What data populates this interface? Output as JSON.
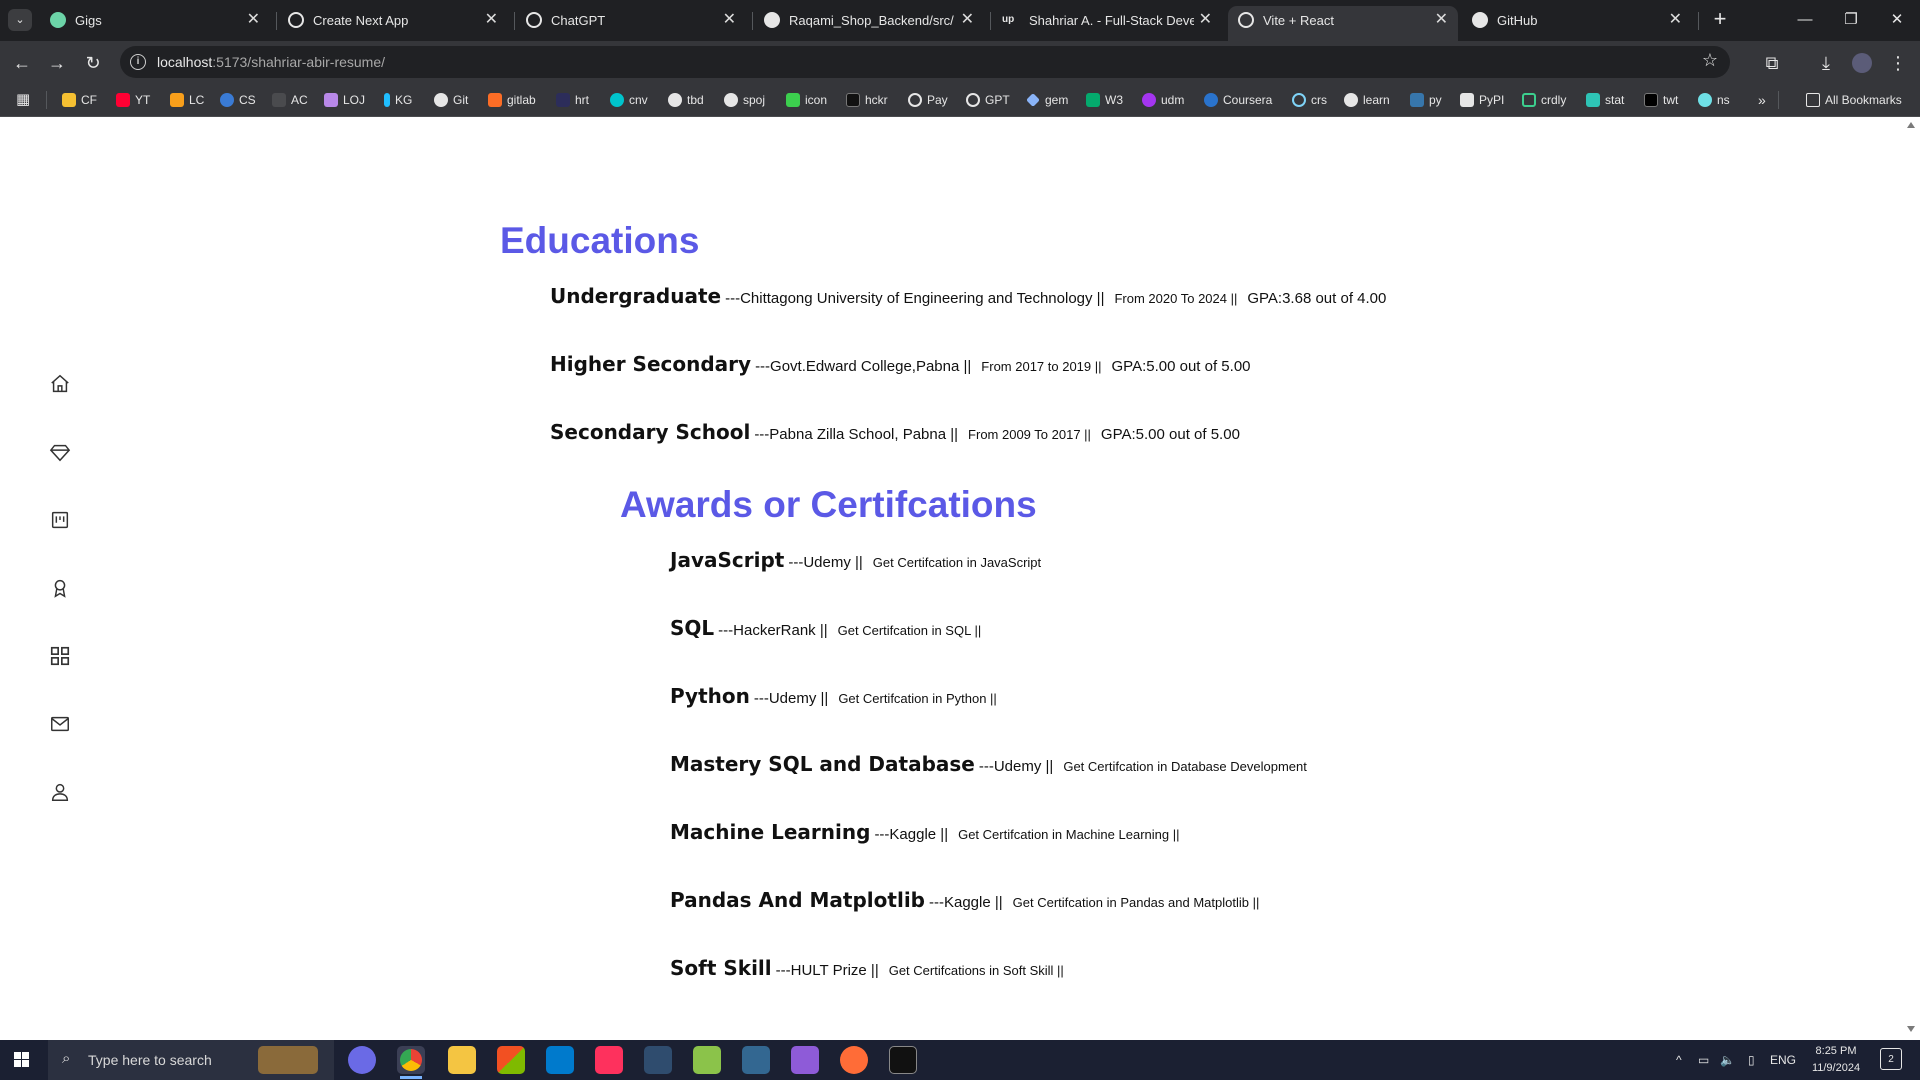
{
  "browser": {
    "tabs": [
      {
        "title": "Gigs",
        "fav_color": "#6cd4a8"
      },
      {
        "title": "Create Next App",
        "fav_color": "#e6e6e6"
      },
      {
        "title": "ChatGPT",
        "fav_color": "#e6e6e6"
      },
      {
        "title": "Raqami_Shop_Backend/src/mai",
        "fav_color": "#e6e6e6"
      },
      {
        "title": "Shahriar A. - Full-Stack Develop",
        "fav_color": "#e6e6e6"
      },
      {
        "title": "Vite + React",
        "fav_color": "#e6e6e6"
      },
      {
        "title": "GitHub",
        "fav_color": "#e6e6e6"
      }
    ],
    "active_tab_index": 5,
    "url_host": "localhost",
    "url_path": ":5173/shahriar-abir-resume/",
    "bookmarks": [
      "CF",
      "YT",
      "LC",
      "CS",
      "AC",
      "LOJ",
      "KG",
      "Git",
      "gitlab",
      "hrt",
      "cnv",
      "tbd",
      "spoj",
      "icon",
      "hckr",
      "Pay",
      "GPT",
      "gem",
      "W3",
      "udm",
      "Coursera",
      "crs",
      "learn",
      "py",
      "PyPI",
      "crdly",
      "stat",
      "twt",
      "ns"
    ],
    "all_bookmarks_label": "All Bookmarks",
    "bookmark_more": "»"
  },
  "sidebar": {
    "icons": [
      "home-icon",
      "diamond-icon",
      "kanban-board-icon",
      "award-icon",
      "grid-icon",
      "mail-icon",
      "user-icon"
    ]
  },
  "educations": {
    "title": "Educations",
    "items": [
      {
        "name": "Undergraduate",
        "org": "---Chittagong University of Engineering and Technology ||",
        "period": "From 2020 To 2024 ||",
        "gpa": "GPA:3.68 out of 4.00"
      },
      {
        "name": "Higher Secondary",
        "org": "---Govt.Edward College,Pabna ||",
        "period": "From 2017 to 2019 ||",
        "gpa": "GPA:5.00 out of 5.00"
      },
      {
        "name": "Secondary School",
        "org": "---Pabna Zilla School, Pabna ||",
        "period": "From 2009 To 2017 ||",
        "gpa": "GPA:5.00 out of 5.00"
      }
    ]
  },
  "awards": {
    "title": "Awards or Certifcations",
    "items": [
      {
        "name": "JavaScript",
        "org": "---Udemy ||",
        "desc": "Get Certifcation in JavaScript"
      },
      {
        "name": "SQL",
        "org": "---HackerRank ||",
        "desc": "Get Certifcation in SQL ||"
      },
      {
        "name": "Python",
        "org": "---Udemy ||",
        "desc": "Get Certifcation in Python ||"
      },
      {
        "name": "Mastery SQL and Database",
        "org": "---Udemy ||",
        "desc": "Get Certifcation in Database Development"
      },
      {
        "name": "Machine Learning",
        "org": "---Kaggle ||",
        "desc": "Get Certifcation in Machine Learning ||"
      },
      {
        "name": "Pandas And Matplotlib",
        "org": "---Kaggle ||",
        "desc": "Get Certifcation in Pandas and Matplotlib ||"
      },
      {
        "name": "Soft Skill",
        "org": "---HULT Prize ||",
        "desc": "Get Certifcations in Soft Skill ||"
      }
    ]
  },
  "taskbar": {
    "search_placeholder": "Type here to search",
    "language": "ENG",
    "time": "8:25 PM",
    "date": "11/9/2024",
    "notification_count": "2"
  }
}
